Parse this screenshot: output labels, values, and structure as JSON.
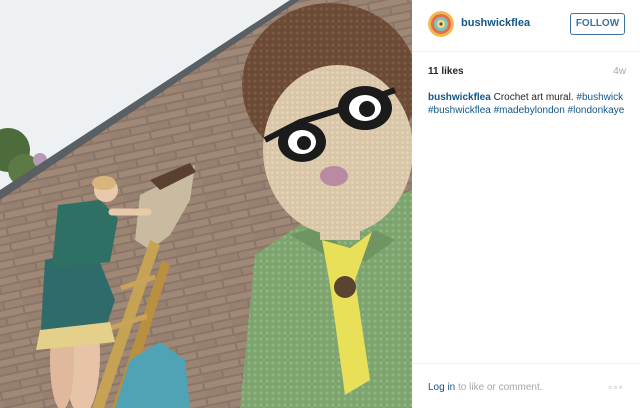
{
  "post": {
    "username": "bushwickflea",
    "follow_label": "FOLLOW",
    "likes": "11 likes",
    "time_ago": "4w",
    "caption": {
      "user": "bushwickflea",
      "text": "Crochet art mural.",
      "hashtags": [
        "#bushwick",
        "#bushwickflea",
        "#madebylondon",
        "#londonkaye"
      ]
    },
    "footer": {
      "login_link": "Log in",
      "login_rest": "to like or comment.",
      "more": "◦◦◦"
    }
  },
  "colors": {
    "link": "#125688",
    "follow_border": "#3f729b",
    "muted": "#a5a7aa"
  },
  "icons": {
    "avatar": "colorful-mandala-avatar",
    "more": "more-options-icon"
  }
}
